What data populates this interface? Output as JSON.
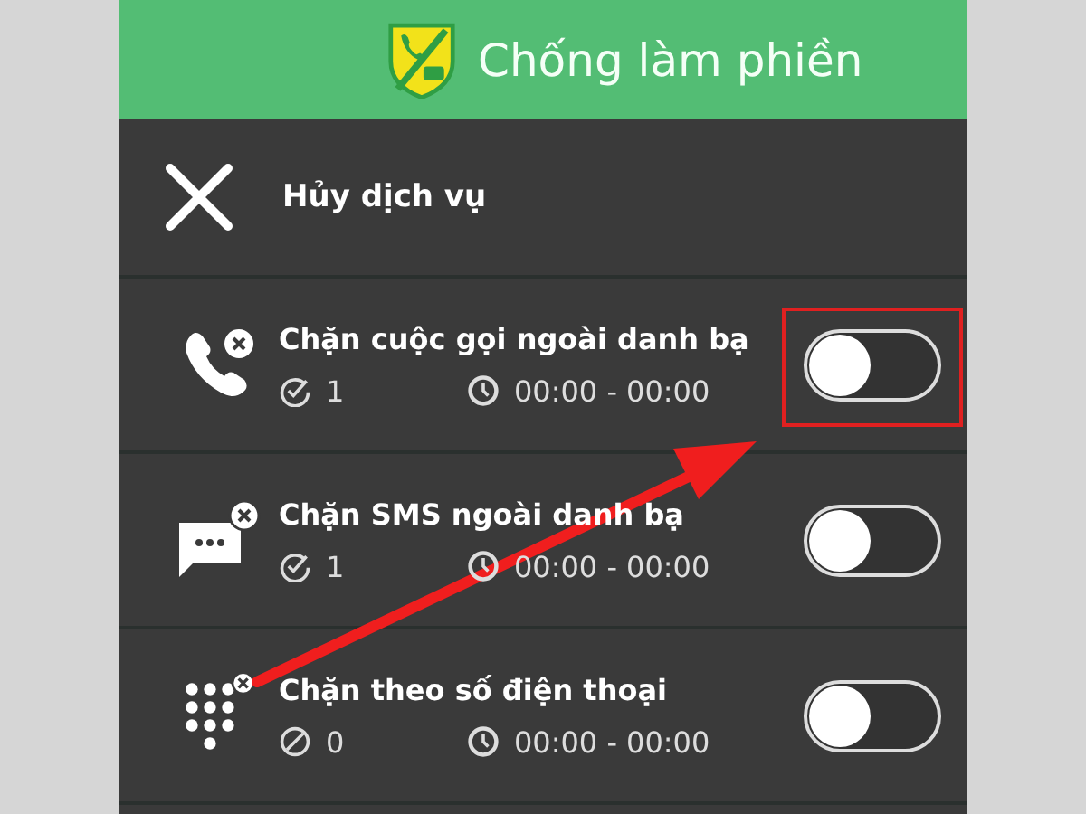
{
  "header": {
    "title": "Chống làm phiền"
  },
  "cancel": {
    "label": "Hủy dịch vụ"
  },
  "rules": [
    {
      "kind": "call",
      "title": "Chặn cuộc gọi ngoài danh bạ",
      "count": {
        "kind": "check",
        "text": "1"
      },
      "time": "00:00 - 00:00",
      "on": false,
      "highlighted": true
    },
    {
      "kind": "sms",
      "title": "Chặn SMS ngoài danh bạ",
      "count": {
        "kind": "check",
        "text": "1"
      },
      "time": "00:00 - 00:00",
      "on": false,
      "highlighted": false
    },
    {
      "kind": "keypad",
      "title": "Chặn theo số điện thoại",
      "count": {
        "kind": "block",
        "text": "0"
      },
      "time": "00:00 - 00:00",
      "on": false,
      "highlighted": false
    }
  ]
}
